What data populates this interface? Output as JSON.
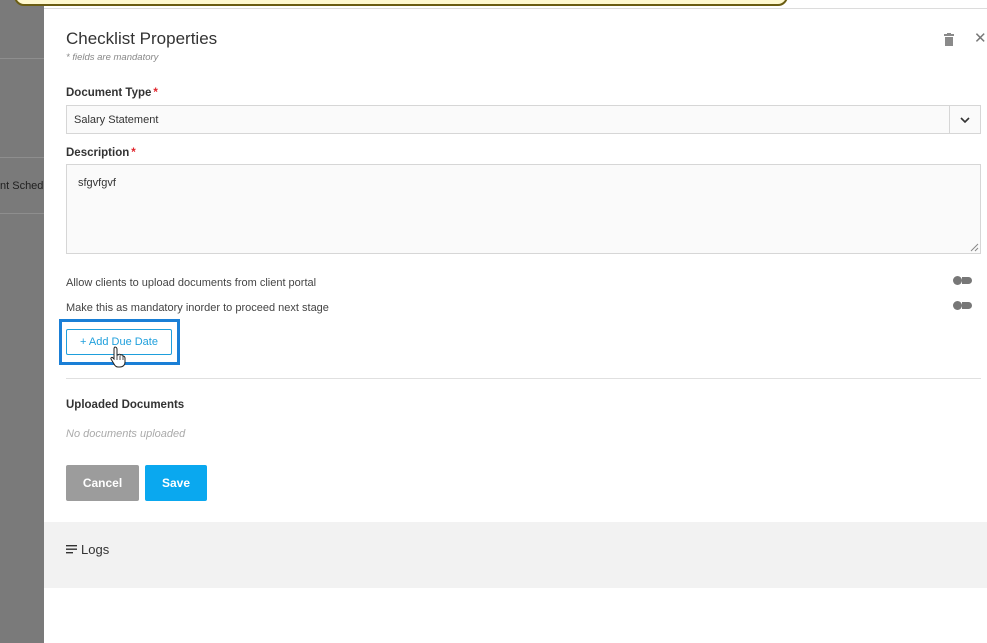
{
  "background": {
    "peek_text": "nt Sched"
  },
  "panel": {
    "title": "Checklist Properties",
    "subtitle": "* fields are mandatory"
  },
  "document_type": {
    "label": "Document Type",
    "required_mark": "*",
    "selected": "Salary Statement"
  },
  "description": {
    "label": "Description",
    "required_mark": "*",
    "value": "sfgvfgvf"
  },
  "toggles": [
    {
      "label": "Allow clients to upload documents from client portal",
      "enabled": false
    },
    {
      "label": "Make this as mandatory inorder to proceed next stage",
      "enabled": false
    }
  ],
  "due_date_button": "+ Add Due Date",
  "uploaded_documents": {
    "heading": "Uploaded Documents",
    "empty_text": "No documents uploaded"
  },
  "actions": {
    "cancel": "Cancel",
    "save": "Save"
  },
  "logs": {
    "label": "Logs"
  },
  "colors": {
    "accent": "#0aa8ef",
    "focus_outline": "#1a7fd6",
    "required": "#e0262d",
    "cancel": "#9c9c9c"
  },
  "icons": [
    "trash-icon",
    "close-icon",
    "chevron-down-icon",
    "resize-grip-icon",
    "toggle-icon",
    "hand-cursor-icon",
    "menu-lines-icon"
  ]
}
